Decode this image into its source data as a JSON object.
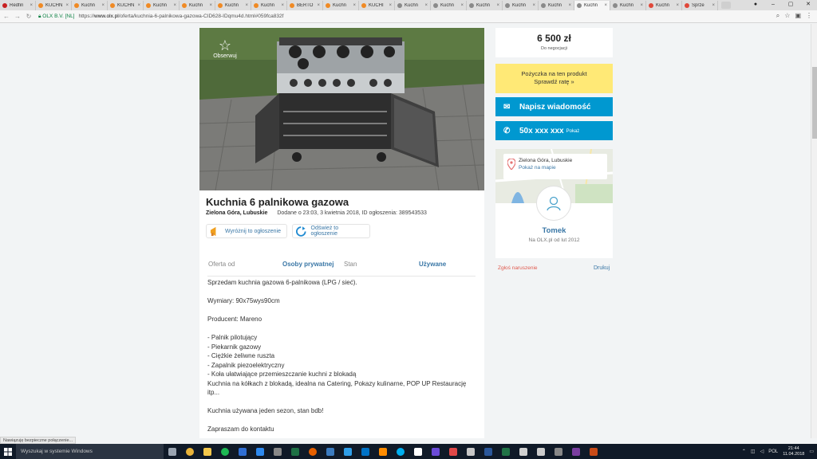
{
  "browser": {
    "tabs": [
      {
        "label": "Redfin",
        "color": "#c82021"
      },
      {
        "label": "KUCHN",
        "color": "#f08a24"
      },
      {
        "label": "Kuchn",
        "color": "#f08a24"
      },
      {
        "label": "KUCHN",
        "color": "#f08a24"
      },
      {
        "label": "Kuchn",
        "color": "#f08a24"
      },
      {
        "label": "Kuchn",
        "color": "#f08a24"
      },
      {
        "label": "Kuchn",
        "color": "#f08a24"
      },
      {
        "label": "Kuchn",
        "color": "#f08a24"
      },
      {
        "label": "BERTO",
        "color": "#f08a24"
      },
      {
        "label": "Kuchn",
        "color": "#f08a24"
      },
      {
        "label": "KUCHI",
        "color": "#f08a24"
      },
      {
        "label": "Kuchn",
        "color": "#8a8a8a"
      },
      {
        "label": "Kuchn",
        "color": "#8a8a8a"
      },
      {
        "label": "Kuchn",
        "color": "#8a8a8a"
      },
      {
        "label": "Kuchn",
        "color": "#8a8a8a"
      },
      {
        "label": "Kuchn",
        "color": "#8a8a8a"
      },
      {
        "label": "Kuchn",
        "color": "#8a8a8a"
      },
      {
        "label": "Kuchn",
        "color": "#8a8a8a"
      },
      {
        "label": "Kuchn",
        "color": "#e0483a"
      },
      {
        "label": "Sprze",
        "color": "#e0483a"
      }
    ],
    "active_tab_index": 16,
    "secure_label": "OLX B.V. [NL]",
    "url_prefix": "https://",
    "url_host": "www.olx.pl",
    "url_path": "/oferta/kuchnia-6-palnikowa-gazowa-CID628-IDqmu4d.html#059fca832f",
    "status_text": "Nawiązuję bezpieczne połączenie..."
  },
  "listing": {
    "observe_label": "Obserwuj",
    "title": "Kuchnia 6 palnikowa gazowa",
    "location": "Zielona Góra, Lubuskie",
    "added": "Dodane o 23:03, 3 kwietnia 2018, ID ogłoszenia: 389543533",
    "promote_label": "Wyróżnij to ogłoszenie",
    "refresh_label": "Odśwież to ogłoszenie",
    "details": {
      "offer_from_label": "Oferta od",
      "offer_from_value": "Osoby prywatnej",
      "condition_label": "Stan",
      "condition_value": "Używane"
    },
    "description": "Sprzedam kuchnia gazowa 6-palnikowa (LPG / sieć).\n\nWymiary: 90x75wys90cm\n\nProducent: Mareno\n\n- Palnik pilotujący\n- Piekarnik gazowy\n- Ciężkie żeliwne ruszta\n- Zapalnik piezoelektryczny\n- Koła ułatwiające przemieszczanie kuchni z blokadą\nKuchnia na kółkach z blokadą, idealna na Catering, Pokazy kulinarne, POP UP Restaurację itp...\n\nKuchnia używana jeden sezon, stan bdb!\n\nZapraszam do kontaktu"
  },
  "sidebar": {
    "price": "6 500 zł",
    "negotiable": "Do negocjacji",
    "loan_line1": "Pożyczka na ten produkt",
    "loan_line2": "Sprawdź ratę »",
    "message_button": "Napisz wiadomość",
    "phone_masked": "50x xxx xxx",
    "phone_show": "Pokaż",
    "map_location": "Zielona Góra, Lubuskie",
    "map_show": "Pokaż na mapie",
    "seller_name": "Tomek",
    "seller_since": "Na OLX.pl od lut 2012",
    "report_label": "Zgłoś naruszenie",
    "print_label": "Drukuj"
  },
  "taskbar": {
    "search_placeholder": "Wyszukaj w systemie Windows",
    "language": "POL",
    "time": "21:44",
    "date": "11.04.2018",
    "apps": [
      {
        "name": "task-view",
        "color": "#9aa4b1"
      },
      {
        "name": "chrome",
        "color": "#e8b33a"
      },
      {
        "name": "file-explorer",
        "color": "#f3c74b"
      },
      {
        "name": "spotify",
        "color": "#1db954"
      },
      {
        "name": "app",
        "color": "#2f6ed3"
      },
      {
        "name": "app",
        "color": "#2d89ef"
      },
      {
        "name": "calculator",
        "color": "#888888"
      },
      {
        "name": "excel",
        "color": "#1e7145"
      },
      {
        "name": "firefox",
        "color": "#e66000"
      },
      {
        "name": "app",
        "color": "#3b7bbf"
      },
      {
        "name": "app",
        "color": "#2f9ee8"
      },
      {
        "name": "outlook",
        "color": "#0072c6"
      },
      {
        "name": "app",
        "color": "#ff8c00"
      },
      {
        "name": "skype",
        "color": "#00aff0"
      },
      {
        "name": "app",
        "color": "#ffffff"
      },
      {
        "name": "app",
        "color": "#6b4bd8"
      },
      {
        "name": "maps",
        "color": "#e04848"
      },
      {
        "name": "mail",
        "color": "#c7c7c7"
      },
      {
        "name": "word",
        "color": "#2b579a"
      },
      {
        "name": "excel",
        "color": "#217346"
      },
      {
        "name": "app",
        "color": "#d0d0d0"
      },
      {
        "name": "photos",
        "color": "#cccccc"
      },
      {
        "name": "app",
        "color": "#888888"
      },
      {
        "name": "app",
        "color": "#7a3ea0"
      },
      {
        "name": "app",
        "color": "#c84b18"
      }
    ]
  }
}
